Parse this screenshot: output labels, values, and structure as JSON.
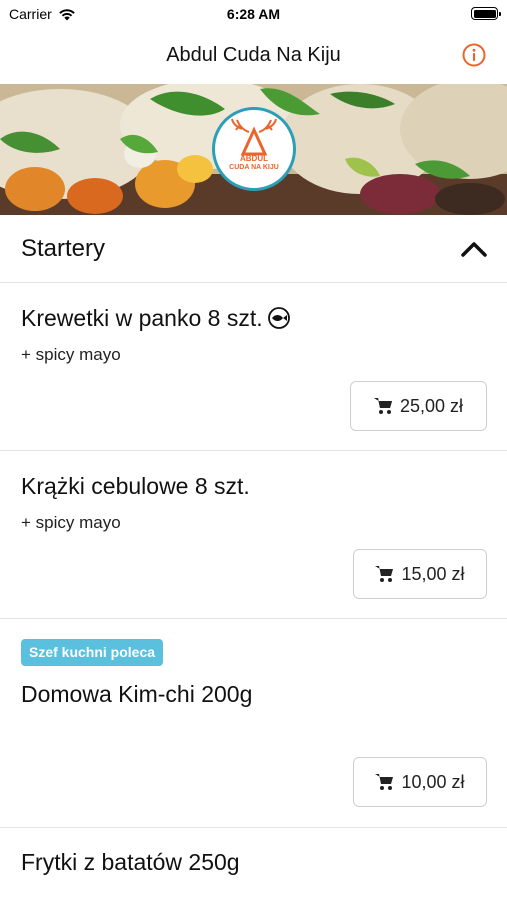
{
  "status_bar": {
    "carrier": "Carrier",
    "time": "6:28 AM"
  },
  "nav": {
    "title": "Abdul Cuda Na Kiju",
    "info_icon": "info-circle-icon"
  },
  "banner": {
    "logo_text_line1": "ABDUL",
    "logo_text_line2": "CUDA NA KIJU"
  },
  "section": {
    "title": "Startery",
    "state": "expanded"
  },
  "items": [
    {
      "title": "Krewetki w panko 8 szt.",
      "description": "+ spicy mayo",
      "price": "25,00 zł",
      "icon": "fish-icon"
    },
    {
      "title": "Krążki cebulowe 8 szt.",
      "description": "+ spicy mayo",
      "price": "15,00 zł"
    },
    {
      "badge": "Szef kuchni poleca",
      "title": "Domowa Kim-chi 200g",
      "price": "10,00 zł"
    },
    {
      "title": "Frytki z batatów 250g"
    }
  ],
  "colors": {
    "accent": "#e8662c",
    "badge": "#5bc0de",
    "logo_ring": "#2a9fb8"
  }
}
